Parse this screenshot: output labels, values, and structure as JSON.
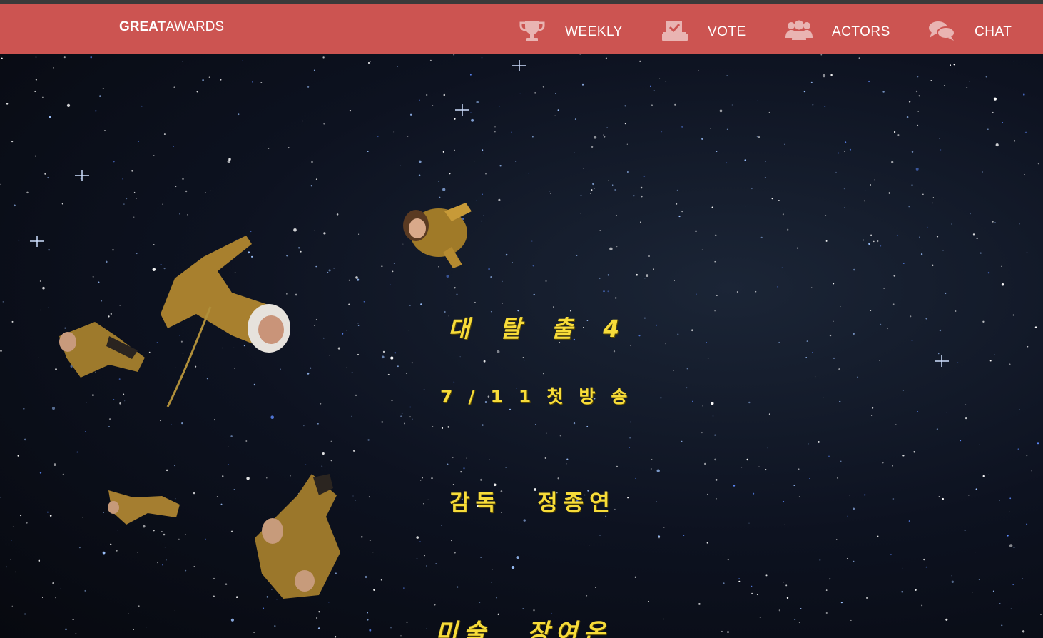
{
  "nav": {
    "brand_bold": "GREAT",
    "brand_light": "AWARDS",
    "items": [
      {
        "label": "WEEKLY",
        "icon": "trophy-icon"
      },
      {
        "label": "VOTE",
        "icon": "ballot-box-icon"
      },
      {
        "label": "ACTORS",
        "icon": "users-icon"
      },
      {
        "label": "CHAT",
        "icon": "chat-bubbles-icon"
      }
    ]
  },
  "hero": {
    "title": "대탈출4",
    "premiere": "7/11첫방송",
    "credits": [
      {
        "role": "감독",
        "name": "정종연"
      },
      {
        "role": "미술",
        "name": "장여온"
      }
    ]
  },
  "colors": {
    "navbar": "#cc5451",
    "accent_text": "#f7dc3a",
    "background": "#0a0d14"
  }
}
